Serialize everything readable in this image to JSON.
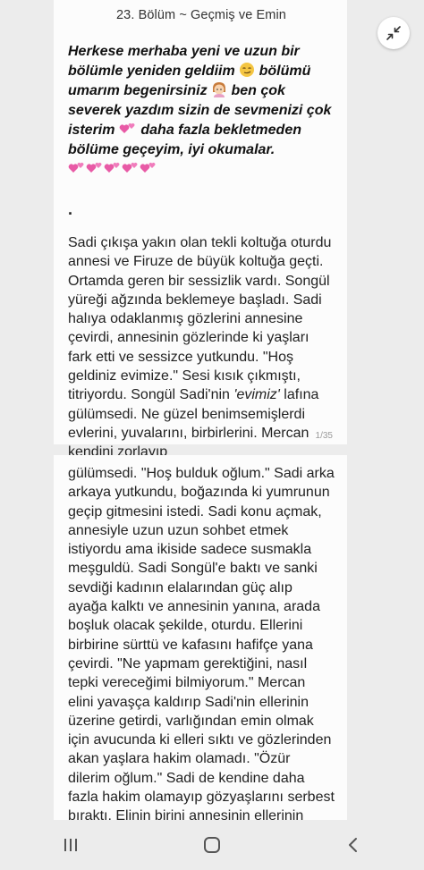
{
  "chapter": {
    "title": "23. Bölüm ~ Geçmiş ve Emin"
  },
  "page1": {
    "intro_part1": "Herkese merhaba yeni ve uzun bir bölümle yeniden geldiim ",
    "intro_part2": " bölümü umarım begenirsiniz ",
    "intro_part3": " ben çok severek yazdım sizin de sevmenizi çok isterim ",
    "intro_part4": " daha fazla bekletmeden bölüme geçeyim, iyi okumalar.",
    "separator": ".",
    "body_before_italic": "Sadi çıkışa yakın olan tekli koltuğa oturdu annesi ve Firuze de büyük koltuğa geçti. Ortamda geren bir sessizlik vardı. Songül yüreği ağzında beklemeye başladı. Sadi halıya odaklanmış gözlerini annesine çevirdi, annesinin gözlerinde ki yaşları fark etti ve sessizce yutkundu. \"Hoş geldiniz evimize.\" Sesi kısık çıkmıştı, titriyordu. Songül Sadi'nin ",
    "body_italic": "'evimiz'",
    "body_after_italic": " lafına gülümsedi. Ne güzel benimsemişlerdi evlerini, yuvalarını, birbirlerini. Mercan kendini zorlayıp",
    "page_number": "1/35"
  },
  "page2": {
    "body": "gülümsedi. \"Hoş bulduk oğlum.\" Sadi arka arkaya yutkundu, boğazında ki yumrunun geçip gitmesini istedi. Sadi konu açmak, annesiyle uzun uzun sohbet etmek istiyordu ama ikiside sadece susmakla meşguldü. Sadi Songül'e baktı ve sanki sevdiği kadının elalarından güç alıp ayağa kalktı ve annesinin yanına, arada boşluk olacak şekilde, oturdu. Ellerini birbirine sürttü ve kafasını hafifçe yana çevirdi. \"Ne yapmam gerektiğini, nasıl tepki vereceğimi bilmiyorum.\" Mercan elini yavaşça kaldırıp Sadi'nin ellerinin üzerine getirdi, varlığından emin olmak için avucunda ki elleri sıktı ve gözlerinden akan yaşlara hakim olamadı. \"Özür dilerim oğlum.\" Sadi de kendine daha fazla hakim olamayıp gözyaşlarını serbest bıraktı. Elinin birini annesinin ellerinin üzerine koydu. \"Sen niye özür diliyorsun ki? Tüm suç benim, her şeyi"
  },
  "icons": {
    "collapse": "collapse-arrows-icon",
    "smirk_emoji": "smirking-face-emoji",
    "person_emoji": "person-emoji",
    "hearts_emoji": "two-hearts-emoji",
    "nav_recent": "recent-apps-icon",
    "nav_home": "home-icon",
    "nav_back": "back-icon"
  },
  "colors": {
    "heart": "#e85aa6",
    "emoji_face": "#f4c542"
  }
}
